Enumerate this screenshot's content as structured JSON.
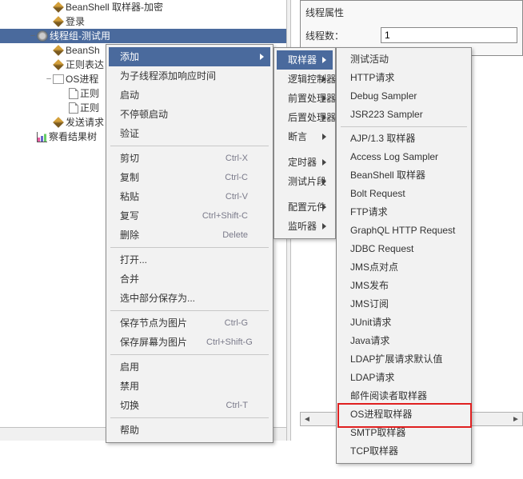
{
  "tree": {
    "rows": [
      {
        "indent": 56,
        "twisty": "",
        "icon": "pen",
        "label": "BeanShell 取样器-加密"
      },
      {
        "indent": 56,
        "twisty": "",
        "icon": "pen",
        "label": "登录"
      },
      {
        "indent": 36,
        "twisty": "–",
        "icon": "gear",
        "label": "线程组-测试用",
        "sel": true
      },
      {
        "indent": 56,
        "twisty": "",
        "icon": "pen",
        "label": "BeanSh"
      },
      {
        "indent": 56,
        "twisty": "",
        "icon": "pen",
        "label": "正则表达"
      },
      {
        "indent": 56,
        "twisty": "–",
        "icon": "os",
        "label": "OS进程"
      },
      {
        "indent": 76,
        "twisty": "",
        "icon": "page",
        "label": "正则"
      },
      {
        "indent": 76,
        "twisty": "",
        "icon": "page",
        "label": "正则"
      },
      {
        "indent": 56,
        "twisty": "",
        "icon": "pen",
        "label": "发送请求"
      },
      {
        "indent": 36,
        "twisty": "",
        "icon": "chart",
        "label": "察看结果树"
      }
    ]
  },
  "props": {
    "group_title": "线程属性",
    "threads_label": "线程数：",
    "threads_value": "1"
  },
  "menu_main": {
    "groups": [
      [
        {
          "label": "添加",
          "submenu": true,
          "hover": true
        },
        {
          "label": "为子线程添加响应时间"
        },
        {
          "label": "启动"
        },
        {
          "label": "不停顿启动"
        },
        {
          "label": "验证"
        }
      ],
      [
        {
          "label": "剪切",
          "shortcut": "Ctrl-X"
        },
        {
          "label": "复制",
          "shortcut": "Ctrl-C"
        },
        {
          "label": "粘贴",
          "shortcut": "Ctrl-V"
        },
        {
          "label": "复写",
          "shortcut": "Ctrl+Shift-C"
        },
        {
          "label": "删除",
          "shortcut": "Delete"
        }
      ],
      [
        {
          "label": "打开..."
        },
        {
          "label": "合并"
        },
        {
          "label": "选中部分保存为..."
        }
      ],
      [
        {
          "label": "保存节点为图片",
          "shortcut": "Ctrl-G"
        },
        {
          "label": "保存屏幕为图片",
          "shortcut": "Ctrl+Shift-G"
        }
      ],
      [
        {
          "label": "启用"
        },
        {
          "label": "禁用"
        },
        {
          "label": "切换",
          "shortcut": "Ctrl-T"
        }
      ],
      [
        {
          "label": "帮助"
        }
      ]
    ]
  },
  "menu_sub": {
    "items": [
      {
        "label": "取样器",
        "submenu": true,
        "hover": true
      },
      {
        "label": "逻辑控制器",
        "submenu": true
      },
      {
        "label": "前置处理器",
        "submenu": true
      },
      {
        "label": "后置处理器",
        "submenu": true
      },
      {
        "label": "断言",
        "submenu": true
      },
      {
        "label": "定时器",
        "submenu": true
      },
      {
        "label": "测试片段",
        "submenu": true
      },
      {
        "label": "配置元件",
        "submenu": true
      },
      {
        "label": "监听器",
        "submenu": true
      }
    ]
  },
  "menu_leaf": {
    "items": [
      {
        "label": "测试活动"
      },
      {
        "label": "HTTP请求"
      },
      {
        "label": "Debug Sampler"
      },
      {
        "label": "JSR223 Sampler"
      },
      {
        "label": "AJP/1.3 取样器"
      },
      {
        "label": "Access Log Sampler"
      },
      {
        "label": "BeanShell 取样器"
      },
      {
        "label": "Bolt Request"
      },
      {
        "label": "FTP请求"
      },
      {
        "label": "GraphQL HTTP Request"
      },
      {
        "label": "JDBC Request"
      },
      {
        "label": "JMS点对点"
      },
      {
        "label": "JMS发布"
      },
      {
        "label": "JMS订阅"
      },
      {
        "label": "JUnit请求"
      },
      {
        "label": "Java请求"
      },
      {
        "label": "LDAP扩展请求默认值"
      },
      {
        "label": "LDAP请求"
      },
      {
        "label": "邮件阅读者取样器"
      },
      {
        "label": "OS进程取样器",
        "highlight": true
      },
      {
        "label": "SMTP取样器"
      },
      {
        "label": "TCP取样器"
      }
    ]
  }
}
